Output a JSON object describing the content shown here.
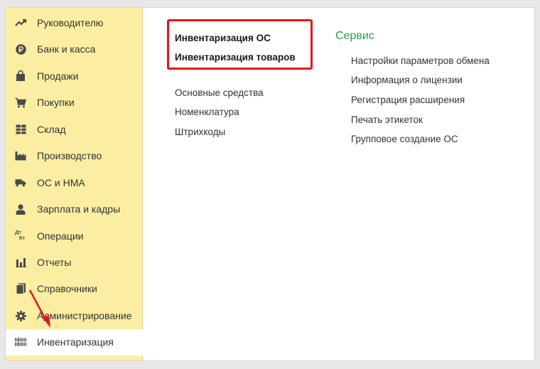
{
  "sidebar": {
    "items": [
      {
        "label": "Руководителю",
        "icon": "trend-chart-icon"
      },
      {
        "label": "Банк и касса",
        "icon": "ruble-coin-icon"
      },
      {
        "label": "Продажи",
        "icon": "shopping-bag-icon"
      },
      {
        "label": "Покупки",
        "icon": "shopping-cart-icon"
      },
      {
        "label": "Склад",
        "icon": "warehouse-grid-icon"
      },
      {
        "label": "Производство",
        "icon": "factory-icon"
      },
      {
        "label": "ОС и НМА",
        "icon": "truck-icon"
      },
      {
        "label": "Зарплата и кадры",
        "icon": "person-icon"
      },
      {
        "label": "Операции",
        "icon": "debit-credit-icon",
        "icon_text_top": "Дт",
        "icon_text_bottom": "Кт"
      },
      {
        "label": "Отчеты",
        "icon": "bar-chart-icon"
      },
      {
        "label": "Справочники",
        "icon": "books-icon"
      },
      {
        "label": "Администрирование",
        "icon": "gear-icon"
      },
      {
        "label": "Инвентаризация",
        "icon": "barcode-icon",
        "active": true
      }
    ]
  },
  "main": {
    "primary_links": [
      "Инвентаризация ОС",
      "Инвентаризация товаров"
    ],
    "secondary_links": [
      "Основные средства",
      "Номенклатура",
      "Штрихкоды"
    ],
    "service": {
      "title": "Сервис",
      "links": [
        "Настройки параметров обмена",
        "Информация о лицензии",
        "Регистрация расширения",
        "Печать этикеток",
        "Групповое создание ОС"
      ]
    }
  },
  "colors": {
    "sidebar_bg": "#fbeea2",
    "section_title": "#2e9a4b",
    "highlight": "#e8141c"
  }
}
